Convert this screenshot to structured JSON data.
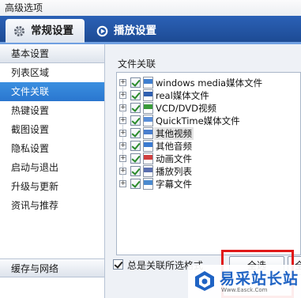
{
  "window": {
    "title": "高级选项"
  },
  "tabs": [
    {
      "label": "常规设置",
      "icon": "gear-icon",
      "active": true
    },
    {
      "label": "播放设置",
      "icon": "play-settings-icon",
      "active": false
    }
  ],
  "sidebar": {
    "header": "基本设置",
    "items": [
      {
        "label": "列表区域"
      },
      {
        "label": "文件关联",
        "active": true
      },
      {
        "label": "热键设置"
      },
      {
        "label": "截图设置"
      },
      {
        "label": "隐私设置"
      },
      {
        "label": "启动与退出"
      },
      {
        "label": "升级与更新"
      },
      {
        "label": "资讯与推荐"
      }
    ],
    "bottom": "缓存与网络"
  },
  "main": {
    "section_title": "文件关联",
    "file_types": [
      {
        "label": "windows media媒体文件",
        "icon": "wmp-file-icon",
        "color": "#3f7fd0"
      },
      {
        "label": "real媒体文件",
        "icon": "real-file-icon",
        "color": "#2f5fb0"
      },
      {
        "label": "VCD/DVD视频",
        "icon": "vcd-file-icon",
        "color": "#3a9a3a"
      },
      {
        "label": "QuickTime媒体文件",
        "icon": "quicktime-file-icon",
        "color": "#5a8fd8"
      },
      {
        "label": "其他视频",
        "icon": "video-file-icon",
        "color": "#4a7fcf",
        "highlighted": true
      },
      {
        "label": "其他音频",
        "icon": "audio-file-icon",
        "color": "#3a7ad0"
      },
      {
        "label": "动画文件",
        "icon": "flash-file-icon",
        "color": "#d04040"
      },
      {
        "label": "播放列表",
        "icon": "playlist-file-icon",
        "color": "#5a6fb0"
      },
      {
        "label": "字幕文件",
        "icon": "subtitle-file-icon",
        "color": "#4a8acf"
      }
    ],
    "always_associate_label": "总是关联所选格式",
    "always_associate_checked": true,
    "select_all_label": "全选",
    "second_button_label": "全"
  },
  "watermark": {
    "text": "易采站长站",
    "url": "Www.Easck.Com"
  },
  "colors": {
    "tab_strip": "#2458a8",
    "active_nav": "#2f7fd8",
    "highlight_frame": "#e01818",
    "watermark_text": "#1f63c4"
  }
}
